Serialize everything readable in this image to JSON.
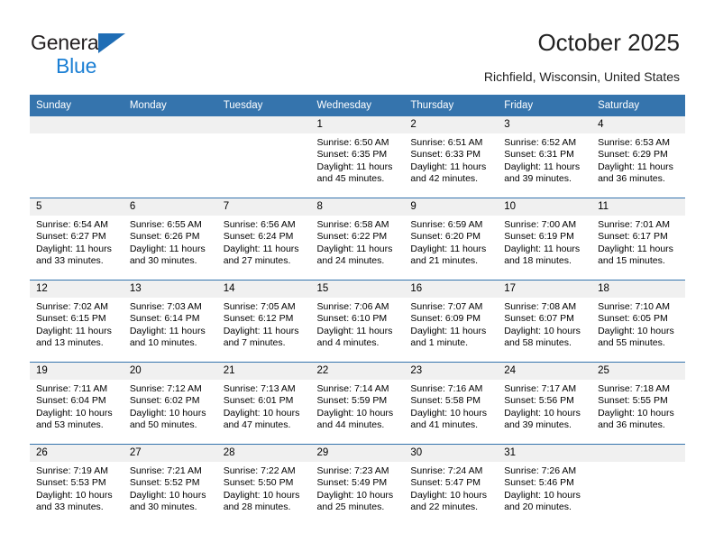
{
  "brand": {
    "name_part1": "General",
    "name_part2": "Blue",
    "accent_color": "#1b7fd4",
    "triangle_color": "#1f6db5"
  },
  "header": {
    "title": "October 2025",
    "location": "Richfield, Wisconsin, United States",
    "header_bg": "#3574ad",
    "band_bg": "#f0f0f0"
  },
  "weekday_headers": [
    "Sunday",
    "Monday",
    "Tuesday",
    "Wednesday",
    "Thursday",
    "Friday",
    "Saturday"
  ],
  "weeks": [
    [
      {
        "day": "",
        "empty": true
      },
      {
        "day": "",
        "empty": true
      },
      {
        "day": "",
        "empty": true
      },
      {
        "day": "1",
        "sunrise": "Sunrise: 6:50 AM",
        "sunset": "Sunset: 6:35 PM",
        "daylight_line1": "Daylight: 11 hours",
        "daylight_line2": "and 45 minutes."
      },
      {
        "day": "2",
        "sunrise": "Sunrise: 6:51 AM",
        "sunset": "Sunset: 6:33 PM",
        "daylight_line1": "Daylight: 11 hours",
        "daylight_line2": "and 42 minutes."
      },
      {
        "day": "3",
        "sunrise": "Sunrise: 6:52 AM",
        "sunset": "Sunset: 6:31 PM",
        "daylight_line1": "Daylight: 11 hours",
        "daylight_line2": "and 39 minutes."
      },
      {
        "day": "4",
        "sunrise": "Sunrise: 6:53 AM",
        "sunset": "Sunset: 6:29 PM",
        "daylight_line1": "Daylight: 11 hours",
        "daylight_line2": "and 36 minutes."
      }
    ],
    [
      {
        "day": "5",
        "sunrise": "Sunrise: 6:54 AM",
        "sunset": "Sunset: 6:27 PM",
        "daylight_line1": "Daylight: 11 hours",
        "daylight_line2": "and 33 minutes."
      },
      {
        "day": "6",
        "sunrise": "Sunrise: 6:55 AM",
        "sunset": "Sunset: 6:26 PM",
        "daylight_line1": "Daylight: 11 hours",
        "daylight_line2": "and 30 minutes."
      },
      {
        "day": "7",
        "sunrise": "Sunrise: 6:56 AM",
        "sunset": "Sunset: 6:24 PM",
        "daylight_line1": "Daylight: 11 hours",
        "daylight_line2": "and 27 minutes."
      },
      {
        "day": "8",
        "sunrise": "Sunrise: 6:58 AM",
        "sunset": "Sunset: 6:22 PM",
        "daylight_line1": "Daylight: 11 hours",
        "daylight_line2": "and 24 minutes."
      },
      {
        "day": "9",
        "sunrise": "Sunrise: 6:59 AM",
        "sunset": "Sunset: 6:20 PM",
        "daylight_line1": "Daylight: 11 hours",
        "daylight_line2": "and 21 minutes."
      },
      {
        "day": "10",
        "sunrise": "Sunrise: 7:00 AM",
        "sunset": "Sunset: 6:19 PM",
        "daylight_line1": "Daylight: 11 hours",
        "daylight_line2": "and 18 minutes."
      },
      {
        "day": "11",
        "sunrise": "Sunrise: 7:01 AM",
        "sunset": "Sunset: 6:17 PM",
        "daylight_line1": "Daylight: 11 hours",
        "daylight_line2": "and 15 minutes."
      }
    ],
    [
      {
        "day": "12",
        "sunrise": "Sunrise: 7:02 AM",
        "sunset": "Sunset: 6:15 PM",
        "daylight_line1": "Daylight: 11 hours",
        "daylight_line2": "and 13 minutes."
      },
      {
        "day": "13",
        "sunrise": "Sunrise: 7:03 AM",
        "sunset": "Sunset: 6:14 PM",
        "daylight_line1": "Daylight: 11 hours",
        "daylight_line2": "and 10 minutes."
      },
      {
        "day": "14",
        "sunrise": "Sunrise: 7:05 AM",
        "sunset": "Sunset: 6:12 PM",
        "daylight_line1": "Daylight: 11 hours",
        "daylight_line2": "and 7 minutes."
      },
      {
        "day": "15",
        "sunrise": "Sunrise: 7:06 AM",
        "sunset": "Sunset: 6:10 PM",
        "daylight_line1": "Daylight: 11 hours",
        "daylight_line2": "and 4 minutes."
      },
      {
        "day": "16",
        "sunrise": "Sunrise: 7:07 AM",
        "sunset": "Sunset: 6:09 PM",
        "daylight_line1": "Daylight: 11 hours",
        "daylight_line2": "and 1 minute."
      },
      {
        "day": "17",
        "sunrise": "Sunrise: 7:08 AM",
        "sunset": "Sunset: 6:07 PM",
        "daylight_line1": "Daylight: 10 hours",
        "daylight_line2": "and 58 minutes."
      },
      {
        "day": "18",
        "sunrise": "Sunrise: 7:10 AM",
        "sunset": "Sunset: 6:05 PM",
        "daylight_line1": "Daylight: 10 hours",
        "daylight_line2": "and 55 minutes."
      }
    ],
    [
      {
        "day": "19",
        "sunrise": "Sunrise: 7:11 AM",
        "sunset": "Sunset: 6:04 PM",
        "daylight_line1": "Daylight: 10 hours",
        "daylight_line2": "and 53 minutes."
      },
      {
        "day": "20",
        "sunrise": "Sunrise: 7:12 AM",
        "sunset": "Sunset: 6:02 PM",
        "daylight_line1": "Daylight: 10 hours",
        "daylight_line2": "and 50 minutes."
      },
      {
        "day": "21",
        "sunrise": "Sunrise: 7:13 AM",
        "sunset": "Sunset: 6:01 PM",
        "daylight_line1": "Daylight: 10 hours",
        "daylight_line2": "and 47 minutes."
      },
      {
        "day": "22",
        "sunrise": "Sunrise: 7:14 AM",
        "sunset": "Sunset: 5:59 PM",
        "daylight_line1": "Daylight: 10 hours",
        "daylight_line2": "and 44 minutes."
      },
      {
        "day": "23",
        "sunrise": "Sunrise: 7:16 AM",
        "sunset": "Sunset: 5:58 PM",
        "daylight_line1": "Daylight: 10 hours",
        "daylight_line2": "and 41 minutes."
      },
      {
        "day": "24",
        "sunrise": "Sunrise: 7:17 AM",
        "sunset": "Sunset: 5:56 PM",
        "daylight_line1": "Daylight: 10 hours",
        "daylight_line2": "and 39 minutes."
      },
      {
        "day": "25",
        "sunrise": "Sunrise: 7:18 AM",
        "sunset": "Sunset: 5:55 PM",
        "daylight_line1": "Daylight: 10 hours",
        "daylight_line2": "and 36 minutes."
      }
    ],
    [
      {
        "day": "26",
        "sunrise": "Sunrise: 7:19 AM",
        "sunset": "Sunset: 5:53 PM",
        "daylight_line1": "Daylight: 10 hours",
        "daylight_line2": "and 33 minutes."
      },
      {
        "day": "27",
        "sunrise": "Sunrise: 7:21 AM",
        "sunset": "Sunset: 5:52 PM",
        "daylight_line1": "Daylight: 10 hours",
        "daylight_line2": "and 30 minutes."
      },
      {
        "day": "28",
        "sunrise": "Sunrise: 7:22 AM",
        "sunset": "Sunset: 5:50 PM",
        "daylight_line1": "Daylight: 10 hours",
        "daylight_line2": "and 28 minutes."
      },
      {
        "day": "29",
        "sunrise": "Sunrise: 7:23 AM",
        "sunset": "Sunset: 5:49 PM",
        "daylight_line1": "Daylight: 10 hours",
        "daylight_line2": "and 25 minutes."
      },
      {
        "day": "30",
        "sunrise": "Sunrise: 7:24 AM",
        "sunset": "Sunset: 5:47 PM",
        "daylight_line1": "Daylight: 10 hours",
        "daylight_line2": "and 22 minutes."
      },
      {
        "day": "31",
        "sunrise": "Sunrise: 7:26 AM",
        "sunset": "Sunset: 5:46 PM",
        "daylight_line1": "Daylight: 10 hours",
        "daylight_line2": "and 20 minutes."
      },
      {
        "day": "",
        "empty": true
      }
    ]
  ]
}
